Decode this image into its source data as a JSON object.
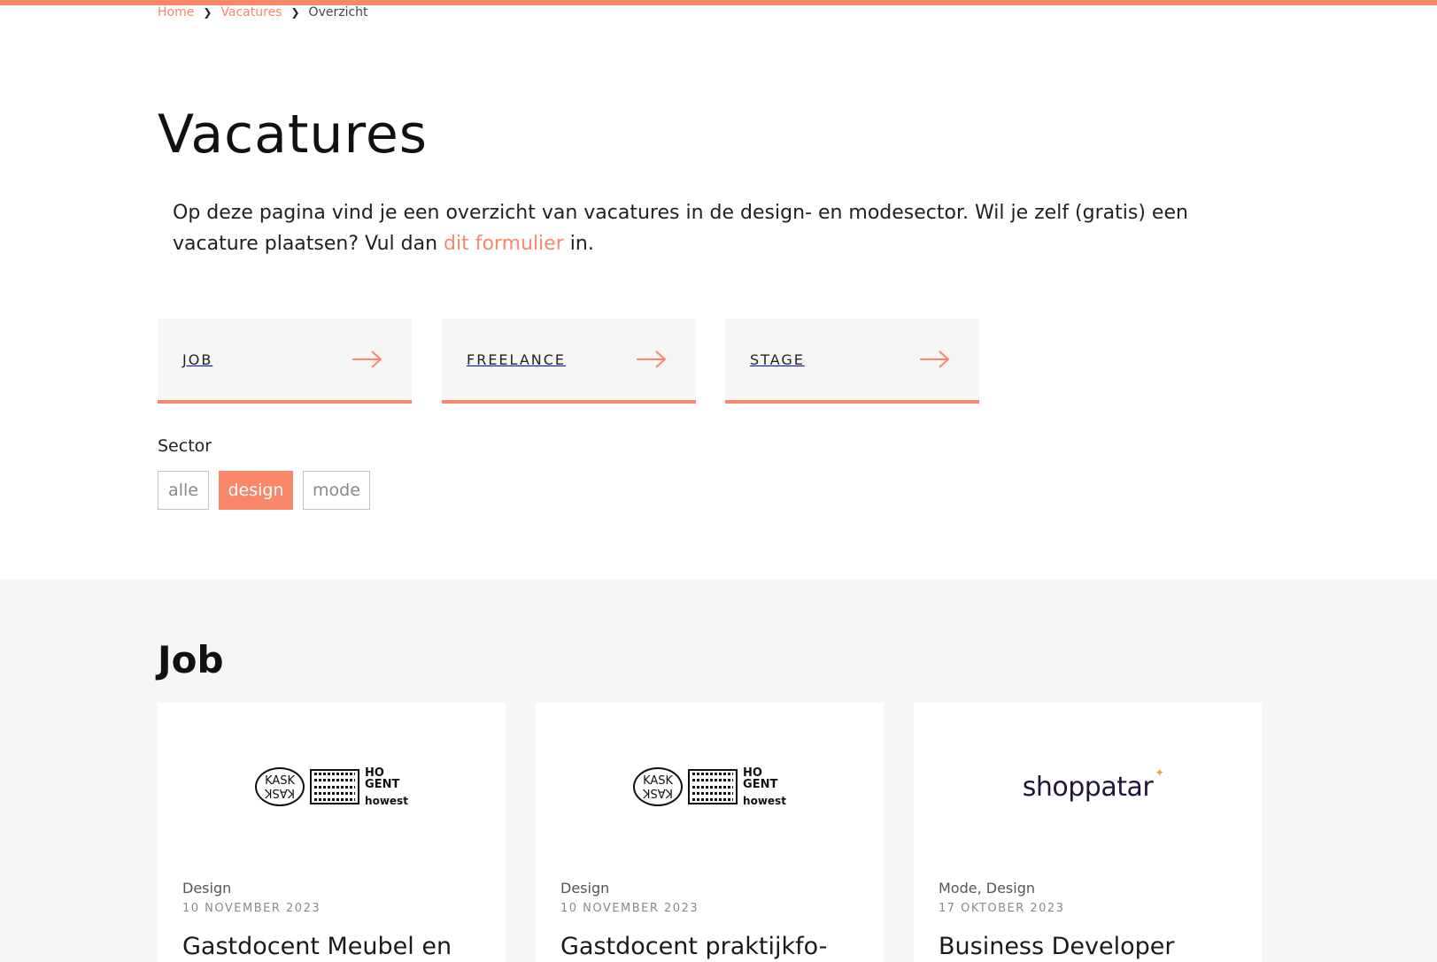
{
  "colors": {
    "accent": "#f9876a",
    "section_bg": "#f6f6f6"
  },
  "breadcrumb": [
    {
      "label": "Home"
    },
    {
      "label": "Vacatures"
    },
    {
      "label": "Overzicht"
    }
  ],
  "page": {
    "title": "Vacatures",
    "intro_before": "Op deze pagina vind je een overzicht van vacatures in de design- en modesector. Wil je zelf (gratis) een vacature plaatsen? Vul dan ",
    "intro_link": "dit formulier",
    "intro_after": " in."
  },
  "types": [
    {
      "label": "JOB",
      "icon": "arrow-right-icon"
    },
    {
      "label": "FREELANCE",
      "icon": "arrow-right-icon"
    },
    {
      "label": "STAGE",
      "icon": "arrow-right-icon"
    }
  ],
  "sector": {
    "label": "Sector",
    "chips": [
      {
        "label": "alle",
        "active": false
      },
      {
        "label": "design",
        "active": true
      },
      {
        "label": "mode",
        "active": false
      }
    ]
  },
  "job_section": {
    "title": "Job",
    "cards": [
      {
        "logo": "kask-hogent-howest-logo",
        "logo_text": {
          "kask_top": "KASK",
          "kask_bottom": "KASK",
          "hogent_1": "HO",
          "hogent_2": "GENT",
          "howest": "howest"
        },
        "sector": "Design",
        "date": "10 NOVEMBER 2023",
        "title": "Gastdocent Meubel en"
      },
      {
        "logo": "kask-hogent-howest-logo",
        "logo_text": {
          "kask_top": "KASK",
          "kask_bottom": "KASK",
          "hogent_1": "HO",
          "hogent_2": "GENT",
          "howest": "howest"
        },
        "sector": "Design",
        "date": "10 NOVEMBER 2023",
        "title": "Gastdocent praktijkfo-"
      },
      {
        "logo": "shoppatar-logo",
        "logo_text": {
          "shop": "shoppatar"
        },
        "sector": "Mode, Design",
        "date": "17 OKTOBER 2023",
        "title": "Business Developer"
      }
    ]
  }
}
